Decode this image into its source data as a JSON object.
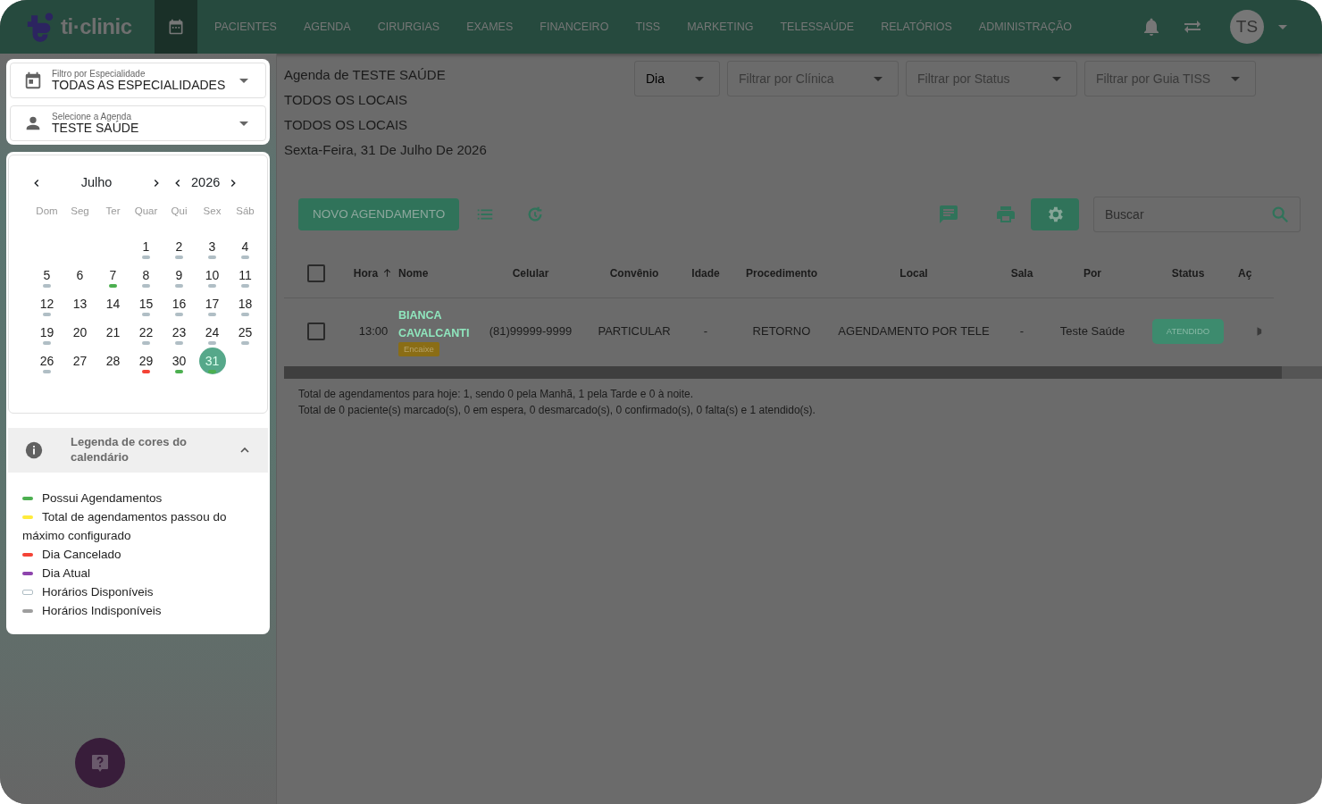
{
  "navbar": {
    "logo": "ti·clinic",
    "calendar_tab": {
      "selected": true
    },
    "items": [
      {
        "label": "PACIENTES",
        "selected": false
      },
      {
        "label": "AGENDA",
        "selected": false
      },
      {
        "label": "CIRURGIAS",
        "selected": false
      },
      {
        "label": "EXAMES",
        "selected": false
      },
      {
        "label": "FINANCEIRO",
        "selected": false
      },
      {
        "label": "TISS",
        "selected": false
      },
      {
        "label": "MARKETING",
        "selected": false
      },
      {
        "label": "TELESSAÚDE",
        "selected": false
      },
      {
        "label": "RELATÓRIOS",
        "selected": false
      },
      {
        "label": "ADMINISTRAÇÃO",
        "selected": false
      }
    ],
    "avatar": "TS"
  },
  "sidebar": {
    "selects": [
      {
        "kind": "specialty",
        "label": "Filtro por Especialidade",
        "value": "TODAS AS ESPECIALIDADES"
      },
      {
        "kind": "person",
        "label": "Selecione a Agenda",
        "value": "TESTE SAÚDE"
      }
    ],
    "calendar": {
      "month": "Julho",
      "year": "2026",
      "weekdays": [
        "Dom",
        "Seg",
        "Ter",
        "Quar",
        "Qui",
        "Sex",
        "Sáb"
      ],
      "weeks": [
        [
          {
            "day": "1",
            "color": "#b0bec5",
            "selected": false
          },
          {
            "day": "2",
            "color": "#b0bec5",
            "selected": false
          },
          {
            "day": "3",
            "color": "#b0bec5",
            "selected": false
          },
          {
            "day": "4",
            "color": "#b0bec5",
            "selected": false
          }
        ],
        [
          {
            "day": "5",
            "color": "#b0bec5",
            "selected": false
          },
          {
            "day": "6",
            "selected": false
          },
          {
            "day": "7",
            "color": "#4caf50",
            "selected": false
          },
          {
            "day": "8",
            "color": "#b0bec5",
            "selected": false
          },
          {
            "day": "9",
            "color": "#b0bec5",
            "selected": false
          },
          {
            "day": "10",
            "color": "#b0bec5",
            "selected": false
          },
          {
            "day": "11",
            "color": "#b0bec5",
            "selected": false
          }
        ],
        [
          {
            "day": "12",
            "color": "#b0bec5",
            "selected": false
          },
          {
            "day": "13",
            "selected": false
          },
          {
            "day": "14",
            "selected": false
          },
          {
            "day": "15",
            "color": "#b0bec5",
            "selected": false
          },
          {
            "day": "16",
            "color": "#b0bec5",
            "selected": false
          },
          {
            "day": "17",
            "color": "#b0bec5",
            "selected": false
          },
          {
            "day": "18",
            "color": "#b0bec5",
            "selected": false
          }
        ],
        [
          {
            "day": "19",
            "color": "#b0bec5",
            "selected": false
          },
          {
            "day": "20",
            "selected": false
          },
          {
            "day": "21",
            "selected": false
          },
          {
            "day": "22",
            "color": "#b0bec5",
            "selected": false
          },
          {
            "day": "23",
            "color": "#b0bec5",
            "selected": false
          },
          {
            "day": "24",
            "color": "#b0bec5",
            "selected": false
          },
          {
            "day": "25",
            "color": "#b0bec5",
            "selected": false
          }
        ],
        [
          {
            "day": "26",
            "color": "#b0bec5",
            "selected": false
          },
          {
            "day": "27",
            "selected": false
          },
          {
            "day": "28",
            "selected": false
          },
          {
            "day": "29",
            "color": "#f44336",
            "selected": false
          },
          {
            "day": "30",
            "color": "#4caf50",
            "selected": false
          },
          {
            "day": "31",
            "color": "#4caf50",
            "selected": true
          }
        ]
      ]
    },
    "legend": {
      "title": "Legenda de cores do calendário",
      "expanded": true,
      "items": [
        {
          "label": "Possui Agendamentos",
          "kind": "filled",
          "color": "#4caf50"
        },
        {
          "label": "Total de agendamentos passou do máximo configurado",
          "kind": "filled",
          "color": "#ffeb3b"
        },
        {
          "label": "Dia Cancelado",
          "kind": "filled",
          "color": "#f44336"
        },
        {
          "label": "Dia Atual",
          "kind": "filled",
          "color": "#8e44ad"
        },
        {
          "label": "Horários Disponíveis",
          "kind": "outline",
          "color": "#b0bec5"
        },
        {
          "label": "Horários Indisponíveis",
          "kind": "filled",
          "color": "#9e9e9e"
        }
      ]
    }
  },
  "header": {
    "lines": [
      "Agenda de TESTE SAÚDE",
      "TODOS OS LOCAIS",
      "TODOS OS LOCAIS",
      "Sexta-Feira, 31 De Julho De 2026"
    ],
    "filters": [
      {
        "value": "Dia"
      },
      {
        "placeholder": "Filtrar por Clínica"
      },
      {
        "placeholder": "Filtrar por Status"
      },
      {
        "placeholder": "Filtrar por Guia TISS"
      }
    ]
  },
  "toolbar": {
    "new_button": "NOVO AGENDAMENTO",
    "search": {
      "placeholder": "Buscar"
    }
  },
  "table": {
    "select_all": {
      "checked": false
    },
    "columns": [
      "Hora",
      "Nome",
      "Celular",
      "Convênio",
      "Idade",
      "Procedimento",
      "Local",
      "Sala",
      "Por",
      "Status",
      "Aç"
    ],
    "rows": [
      {
        "checked": false,
        "hora": "13:00",
        "nome": "BIANCA CAVALCANTI",
        "tag": "Encaixe",
        "celular": "(81)99999-9999",
        "convenio": "PARTICULAR",
        "idade": "-",
        "procedimento": "RETORNO",
        "local": "AGENDAMENTO POR TELE",
        "sala": "-",
        "por": "Teste Saúde",
        "status": "ATENDIDO"
      }
    ]
  },
  "summary": [
    "Total de agendamentos para hoje: 1, sendo 0 pela Manhã, 1 pela Tarde e 0 à noite.",
    "Total de 0 paciente(s) marcado(s), 0 em espera, 0 desmarcado(s), 0 confirmado(s), 0 falta(s) e 1 atendido(s)."
  ]
}
